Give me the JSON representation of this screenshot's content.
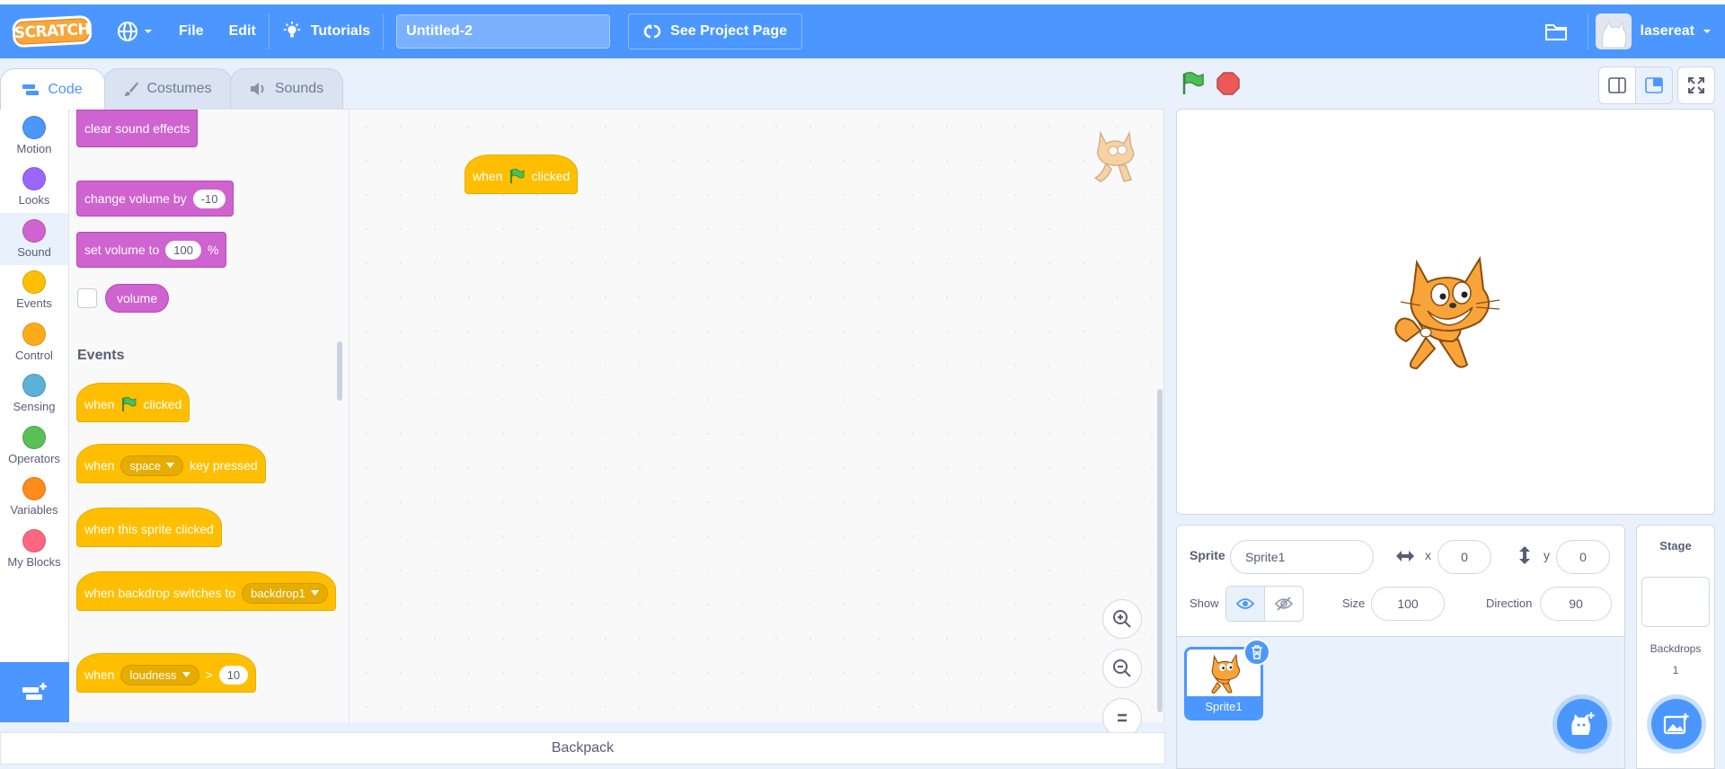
{
  "menubar": {
    "logo_text": "SCRATCH",
    "file_label": "File",
    "edit_label": "Edit",
    "tutorials_label": "Tutorials",
    "project_title": "Untitled-2",
    "see_project_label": "See Project Page",
    "username": "lasereat"
  },
  "tabs": {
    "code": "Code",
    "costumes": "Costumes",
    "sounds": "Sounds"
  },
  "categories": [
    {
      "label": "Motion",
      "color": "#4c97ff"
    },
    {
      "label": "Looks",
      "color": "#9966ff"
    },
    {
      "label": "Sound",
      "color": "#cf63cf"
    },
    {
      "label": "Events",
      "color": "#ffbf00"
    },
    {
      "label": "Control",
      "color": "#ffab19"
    },
    {
      "label": "Sensing",
      "color": "#5cb1d6"
    },
    {
      "label": "Operators",
      "color": "#59c059"
    },
    {
      "label": "Variables",
      "color": "#ff8c1a"
    },
    {
      "label": "My Blocks",
      "color": "#ff6680"
    }
  ],
  "palette": {
    "clear_sound": "clear sound effects",
    "change_volume": "change volume by",
    "change_volume_value": "-10",
    "set_volume": "set volume to",
    "set_volume_value": "100",
    "set_volume_unit": "%",
    "volume_reporter": "volume",
    "events_heading": "Events",
    "when": "when",
    "clicked": "clicked",
    "key_value": "space",
    "key_pressed": "key pressed",
    "sprite_clicked": "when this sprite clicked",
    "backdrop_switches": "when backdrop switches to",
    "backdrop_value": "backdrop1",
    "loudness_value": "loudness",
    "gt": ">",
    "loudness_threshold": "10"
  },
  "workspace": {
    "script_when": "when",
    "script_clicked": "clicked"
  },
  "backpack_label": "Backpack",
  "sprite_info": {
    "sprite_label": "Sprite",
    "sprite_name": "Sprite1",
    "x_label": "x",
    "x_value": "0",
    "y_label": "y",
    "y_value": "0",
    "show_label": "Show",
    "size_label": "Size",
    "size_value": "100",
    "direction_label": "Direction",
    "direction_value": "90"
  },
  "sprite_list": {
    "sprite_name": "Sprite1"
  },
  "stage_selector": {
    "title": "Stage",
    "backdrops_label": "Backdrops",
    "backdrops_count": "1"
  },
  "colors": {
    "primary": "#4c97ff",
    "sound": "#cf63cf",
    "events": "#ffbf00",
    "green_flag": "#4cbf56",
    "stop": "#ec5959"
  }
}
